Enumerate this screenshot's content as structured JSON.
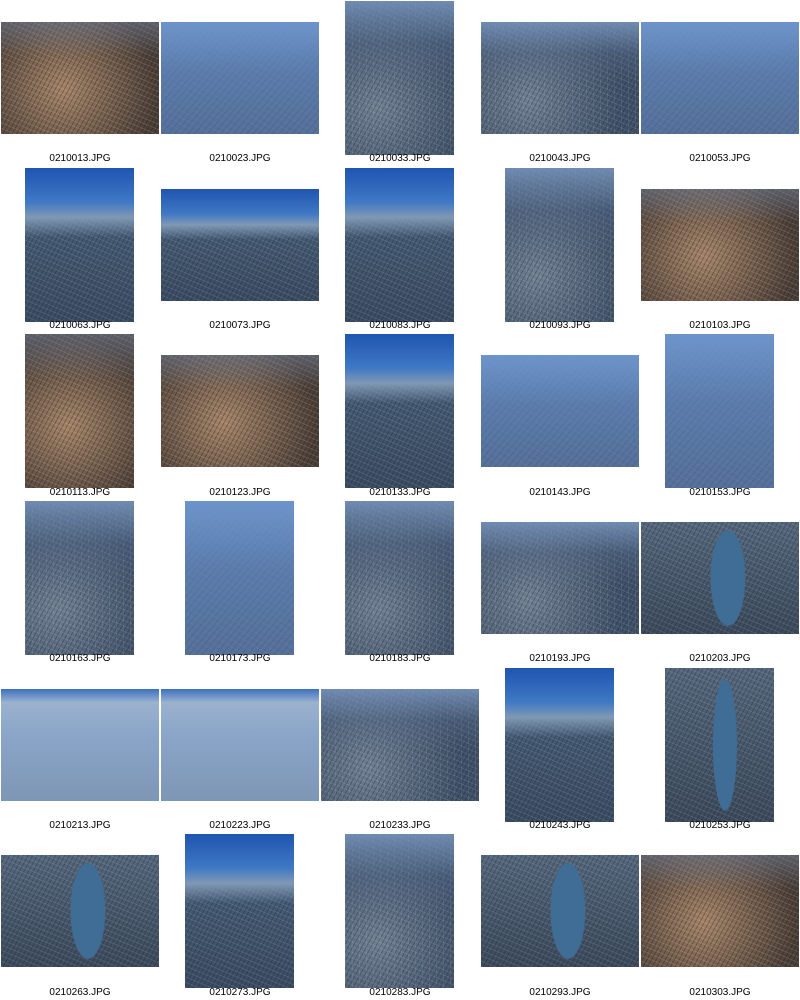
{
  "contact_sheet": {
    "thumbnails": [
      {
        "filename": "0210013.JPG",
        "style": "warm"
      },
      {
        "filename": "0210023.JPG",
        "style": "haze"
      },
      {
        "filename": "0210033.JPG",
        "style": "city"
      },
      {
        "filename": "0210043.JPG",
        "style": "city"
      },
      {
        "filename": "0210053.JPG",
        "style": "haze"
      },
      {
        "filename": "0210063.JPG",
        "style": "sky"
      },
      {
        "filename": "0210073.JPG",
        "style": "sky"
      },
      {
        "filename": "0210083.JPG",
        "style": "sky"
      },
      {
        "filename": "0210093.JPG",
        "style": "city"
      },
      {
        "filename": "0210103.JPG",
        "style": "warm"
      },
      {
        "filename": "0210113.JPG",
        "style": "warm"
      },
      {
        "filename": "0210123.JPG",
        "style": "warm"
      },
      {
        "filename": "0210133.JPG",
        "style": "sky"
      },
      {
        "filename": "0210143.JPG",
        "style": "haze"
      },
      {
        "filename": "0210153.JPG",
        "style": "haze"
      },
      {
        "filename": "0210163.JPG",
        "style": "city"
      },
      {
        "filename": "0210173.JPG",
        "style": "haze"
      },
      {
        "filename": "0210183.JPG",
        "style": "city"
      },
      {
        "filename": "0210193.JPG",
        "style": "city"
      },
      {
        "filename": "0210203.JPG",
        "style": "river"
      },
      {
        "filename": "0210213.JPG",
        "style": "mist"
      },
      {
        "filename": "0210223.JPG",
        "style": "mist"
      },
      {
        "filename": "0210233.JPG",
        "style": "city"
      },
      {
        "filename": "0210243.JPG",
        "style": "sky"
      },
      {
        "filename": "0210253.JPG",
        "style": "river"
      },
      {
        "filename": "0210263.JPG",
        "style": "river"
      },
      {
        "filename": "0210273.JPG",
        "style": "sky"
      },
      {
        "filename": "0210283.JPG",
        "style": "city"
      },
      {
        "filename": "0210293.JPG",
        "style": "river"
      },
      {
        "filename": "0210303.JPG",
        "style": "warm"
      }
    ]
  }
}
